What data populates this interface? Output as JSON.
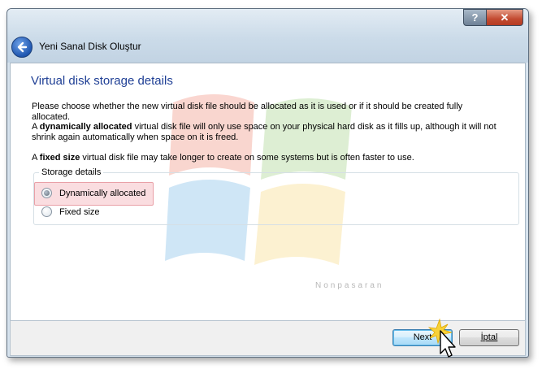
{
  "window": {
    "title": "Yeni Sanal Disk Oluştur",
    "help_label": "?",
    "close_label": "✕"
  },
  "page": {
    "heading": "Virtual disk storage details",
    "intro": "Please choose whether the new virtual disk file should be allocated as it is used or if it should be created fully allocated.",
    "dynamic_desc": {
      "prefix": "A ",
      "bold": "dynamically allocated",
      "rest": " virtual disk file will only use space on your physical hard disk as it fills up, although it will not shrink again automatically when space on it is freed."
    },
    "fixed_desc": {
      "prefix": "A ",
      "bold": "fixed size",
      "rest": " virtual disk file may take longer to create on some systems but is often faster to use."
    },
    "storage_group": {
      "legend": "Storage details",
      "options": [
        {
          "label": "Dynamically allocated",
          "checked": true
        },
        {
          "label": "Fixed size",
          "checked": false
        }
      ]
    },
    "watermark": "Nonpasaran"
  },
  "footer": {
    "next_label": "Next",
    "cancel_label": "İptal"
  },
  "colors": {
    "heading": "#1f3f95",
    "highlight": "#f4b4ba",
    "next_button": "#bee6fd"
  },
  "icons": [
    "back-arrow-icon",
    "help-icon",
    "close-icon",
    "mouse-cursor-icon"
  ]
}
